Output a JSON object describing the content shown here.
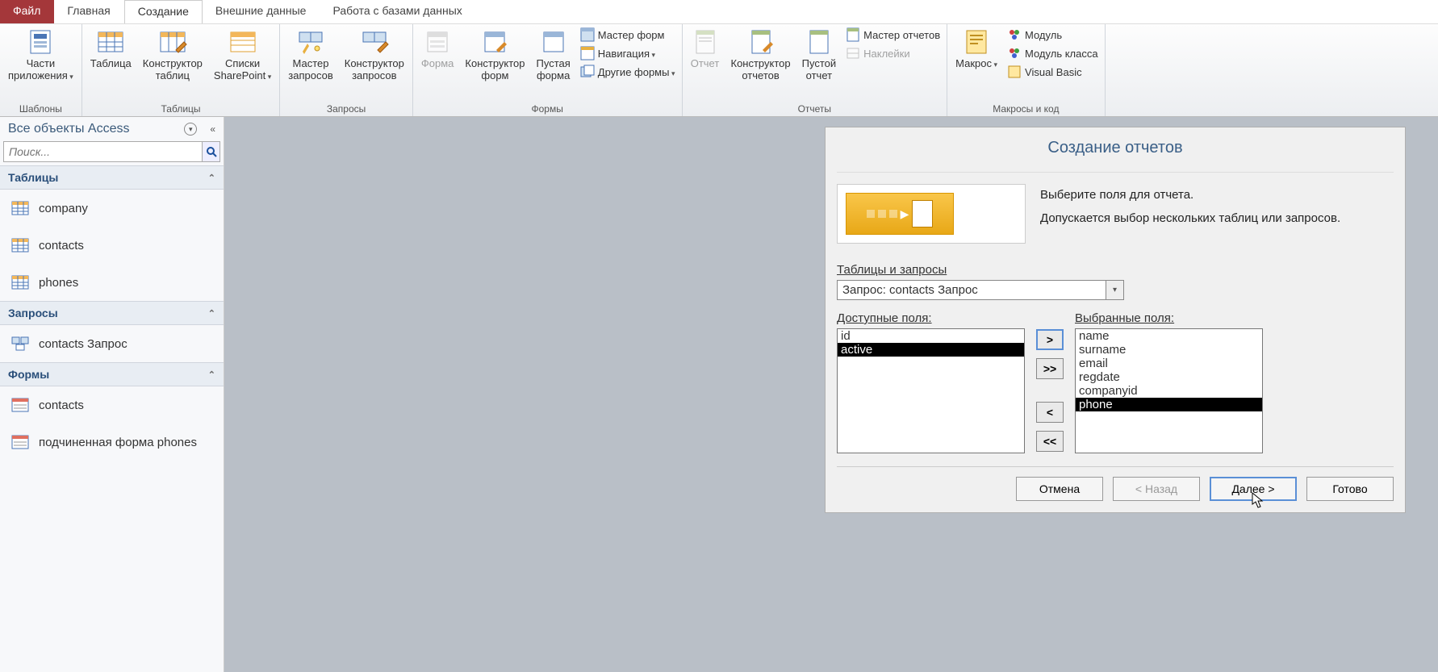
{
  "menu": {
    "file": "Файл",
    "home": "Главная",
    "create": "Создание",
    "external": "Внешние данные",
    "dbtools": "Работа с базами данных"
  },
  "ribbon": {
    "group_templates": "Шаблоны",
    "group_tables": "Таблицы",
    "group_queries": "Запросы",
    "group_forms": "Формы",
    "group_reports": "Отчеты",
    "group_macros": "Макросы и код",
    "app_parts": "Части\nприложения",
    "table": "Таблица",
    "table_design": "Конструктор\nтаблиц",
    "sharepoint": "Списки\nSharePoint",
    "query_wiz": "Мастер\nзапросов",
    "query_design": "Конструктор\nзапросов",
    "form": "Форма",
    "form_design": "Конструктор\nформ",
    "blank_form": "Пустая\nформа",
    "form_wizard": "Мастер форм",
    "navigation": "Навигация",
    "other_forms": "Другие формы",
    "report": "Отчет",
    "report_design": "Конструктор\nотчетов",
    "blank_report": "Пустой\nотчет",
    "report_wizard": "Мастер отчетов",
    "labels": "Наклейки",
    "macro": "Макрос",
    "module": "Модуль",
    "class_module": "Модуль класса",
    "visual_basic": "Visual Basic"
  },
  "nav": {
    "title": "Все объекты Access",
    "search_placeholder": "Поиск...",
    "tables_hdr": "Таблицы",
    "queries_hdr": "Запросы",
    "forms_hdr": "Формы",
    "tables": [
      "company",
      "contacts",
      "phones"
    ],
    "queries": [
      "contacts Запрос"
    ],
    "forms": [
      "contacts",
      "подчиненная форма phones"
    ]
  },
  "wizard": {
    "title": "Создание отчетов",
    "prompt1": "Выберите поля для отчета.",
    "prompt2": "Допускается выбор нескольких таблиц или запросов.",
    "tables_queries_label": "Таблицы и запросы",
    "selected_source": "Запрос: contacts Запрос",
    "available_label": "Доступные поля:",
    "selected_label": "Выбранные поля:",
    "available": [
      "id",
      "active"
    ],
    "available_selected_index": 1,
    "selected": [
      "name",
      "surname",
      "email",
      "regdate",
      "companyid",
      "phone"
    ],
    "selected_selected_index": 5,
    "btn_add": ">",
    "btn_add_all": ">>",
    "btn_remove": "<",
    "btn_remove_all": "<<",
    "btn_cancel": "Отмена",
    "btn_back": "< Назад",
    "btn_next": "Далее >",
    "btn_finish": "Готово"
  }
}
